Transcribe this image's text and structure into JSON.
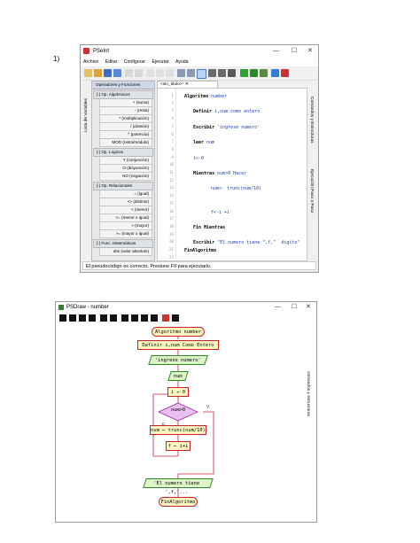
{
  "page_number": "1)",
  "pseint": {
    "title": "PSeInt",
    "menu": [
      "Archivo",
      "Editar",
      "Configurar",
      "Ejecutar",
      "Ayuda"
    ],
    "left_panel_title": "Operadores y Funciones",
    "left_vertical_tab": "Lista de Variables",
    "sections": [
      {
        "title": "Op. Algebraicos",
        "items": [
          "+ (suma)",
          "- (resta)",
          "* (multiplicación)",
          "/ (división)",
          "^ (potencia)",
          "MOD (resto/módulo)"
        ]
      },
      {
        "title": "Op. Logicos",
        "items": [
          "Y (conjunción)",
          "O (disyunción)",
          "NO (negación)"
        ]
      },
      {
        "title": "Op. Relacionales",
        "items": [
          "= (igual)",
          "<> (distinto)",
          "< (menor)",
          "<= (menor o igual)",
          "> (mayor)",
          ">= (mayor o igual)"
        ]
      },
      {
        "title": "Func. Matemáticas",
        "items": [
          "abs (valor absoluto)"
        ]
      }
    ],
    "tab_label": "<sin_titulo>*",
    "line_numbers": [
      "1",
      "2",
      "3",
      "4",
      "5",
      "6",
      "7",
      "8",
      "9",
      "10",
      "11",
      "12",
      "13",
      "14",
      "15",
      "16",
      "17",
      "18",
      "19",
      "20",
      "21",
      "22"
    ],
    "code_lines": [
      {
        "n": 1,
        "text": "Algoritmo number"
      },
      {
        "n": 3,
        "text": "Definir i,num como entero"
      },
      {
        "n": 5,
        "text": "Escribir 'ingrese numero'"
      },
      {
        "n": 7,
        "text": "leer num"
      },
      {
        "n": 9,
        "text": "i<-0"
      },
      {
        "n": 11,
        "text": "Mientras num>0 Hacer"
      },
      {
        "n": 13,
        "text": "num<- trunc(num/10)"
      },
      {
        "n": 16,
        "text": "f<-i +i"
      },
      {
        "n": 18,
        "text": "Fin Mientras"
      },
      {
        "n": 20,
        "text": "Escribir \"El numero tiene \",f,\"  digito\""
      },
      {
        "n": 21,
        "text": "FinAlgoritmo"
      }
    ],
    "right_tabs": [
      "Comandos y Estructuras",
      "Ejecución Paso a Paso"
    ],
    "status": "El pseudocódigo es correcto. Presione F9 para ejecutarlo."
  },
  "psdraw": {
    "title": "PSDraw - number",
    "right_tab": "comandos y estructuras",
    "nodes": {
      "start": "Algoritmo number",
      "define": "Definir i,num Como Entero",
      "write1": "'ingrese numero'",
      "read": "num",
      "assign_i": "i ← 0",
      "cond": "num>0",
      "assign_num": "num ← trunc(num/10)",
      "assign_f": "f ← i+i",
      "write2": "'El numero tiene ',f,'...",
      "end": "FinAlgoritmo"
    },
    "branch_true": "V",
    "branch_false": "F"
  }
}
